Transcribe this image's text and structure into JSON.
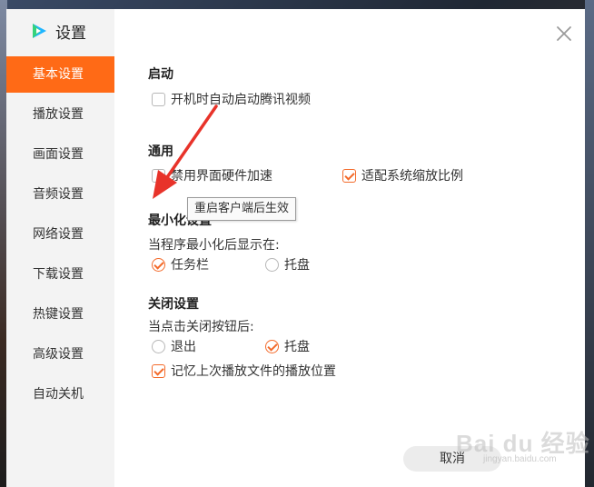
{
  "window": {
    "title": "设置"
  },
  "sidebar": {
    "items": [
      {
        "label": "基本设置",
        "active": true
      },
      {
        "label": "播放设置"
      },
      {
        "label": "画面设置"
      },
      {
        "label": "音频设置"
      },
      {
        "label": "网络设置"
      },
      {
        "label": "下载设置"
      },
      {
        "label": "热键设置"
      },
      {
        "label": "高级设置"
      },
      {
        "label": "自动关机"
      }
    ]
  },
  "startup": {
    "title": "启动",
    "auto_start": {
      "label": "开机时自动启动腾讯视频",
      "checked": false
    }
  },
  "general": {
    "title": "通用",
    "disable_hw_accel": {
      "label": "禁用界面硬件加速",
      "checked": false
    },
    "fit_scaling": {
      "label": "适配系统缩放比例",
      "checked": true
    },
    "tooltip": "重启客户端后生效"
  },
  "minimize": {
    "title": "最小化设置",
    "caption": "当程序最小化后显示在:",
    "options": [
      {
        "label": "任务栏",
        "selected": true
      },
      {
        "label": "托盘",
        "selected": false
      }
    ]
  },
  "close": {
    "title": "关闭设置",
    "caption": "当点击关闭按钮后:",
    "options": [
      {
        "label": "退出",
        "selected": false
      },
      {
        "label": "托盘",
        "selected": true
      }
    ],
    "remember_position": {
      "label": "记忆上次播放文件的播放位置",
      "checked": true
    }
  },
  "footer": {
    "cancel_label": "取消"
  },
  "watermark": {
    "text": "Bai du 经验",
    "sub": "jingyan.baidu.com"
  },
  "icons": {
    "logo": "tencent-video-logo-icon",
    "close": "close-icon",
    "annotation": "red-arrow-icon"
  },
  "colors": {
    "accent": "#ff6a16",
    "check": "#f36a2a",
    "sidebar_bg": "#f3f3f3"
  }
}
